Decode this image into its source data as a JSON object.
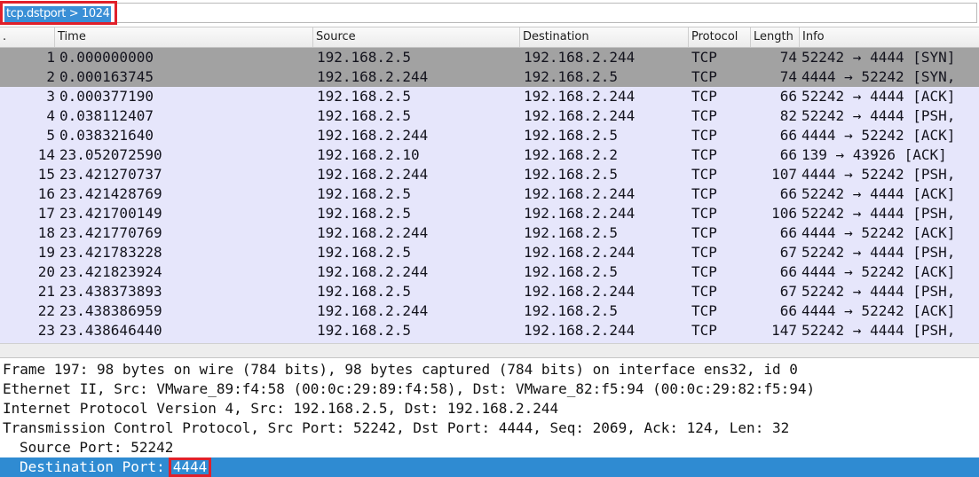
{
  "filter": {
    "value": "tcp.dstport > 1024"
  },
  "columns": {
    "no": ".",
    "time": "Time",
    "source": "Source",
    "destination": "Destination",
    "protocol": "Protocol",
    "length": "Length",
    "info": "Info"
  },
  "packets": [
    {
      "no": "1",
      "time": "0.000000000",
      "source": "192.168.2.5",
      "destination": "192.168.2.244",
      "protocol": "TCP",
      "length": "74",
      "info": "52242 → 4444 [SYN]"
    },
    {
      "no": "2",
      "time": "0.000163745",
      "source": "192.168.2.244",
      "destination": "192.168.2.5",
      "protocol": "TCP",
      "length": "74",
      "info": "4444 → 52242 [SYN,"
    },
    {
      "no": "3",
      "time": "0.000377190",
      "source": "192.168.2.5",
      "destination": "192.168.2.244",
      "protocol": "TCP",
      "length": "66",
      "info": "52242 → 4444 [ACK]"
    },
    {
      "no": "4",
      "time": "0.038112407",
      "source": "192.168.2.5",
      "destination": "192.168.2.244",
      "protocol": "TCP",
      "length": "82",
      "info": "52242 → 4444 [PSH,"
    },
    {
      "no": "5",
      "time": "0.038321640",
      "source": "192.168.2.244",
      "destination": "192.168.2.5",
      "protocol": "TCP",
      "length": "66",
      "info": "4444 → 52242 [ACK]"
    },
    {
      "no": "14",
      "time": "23.052072590",
      "source": "192.168.2.10",
      "destination": "192.168.2.2",
      "protocol": "TCP",
      "length": "66",
      "info": "139 → 43926 [ACK]"
    },
    {
      "no": "15",
      "time": "23.421270737",
      "source": "192.168.2.244",
      "destination": "192.168.2.5",
      "protocol": "TCP",
      "length": "107",
      "info": "4444 → 52242 [PSH,"
    },
    {
      "no": "16",
      "time": "23.421428769",
      "source": "192.168.2.5",
      "destination": "192.168.2.244",
      "protocol": "TCP",
      "length": "66",
      "info": "52242 → 4444 [ACK]"
    },
    {
      "no": "17",
      "time": "23.421700149",
      "source": "192.168.2.5",
      "destination": "192.168.2.244",
      "protocol": "TCP",
      "length": "106",
      "info": "52242 → 4444 [PSH,"
    },
    {
      "no": "18",
      "time": "23.421770769",
      "source": "192.168.2.244",
      "destination": "192.168.2.5",
      "protocol": "TCP",
      "length": "66",
      "info": "4444 → 52242 [ACK]"
    },
    {
      "no": "19",
      "time": "23.421783228",
      "source": "192.168.2.5",
      "destination": "192.168.2.244",
      "protocol": "TCP",
      "length": "67",
      "info": "52242 → 4444 [PSH,"
    },
    {
      "no": "20",
      "time": "23.421823924",
      "source": "192.168.2.244",
      "destination": "192.168.2.5",
      "protocol": "TCP",
      "length": "66",
      "info": "4444 → 52242 [ACK]"
    },
    {
      "no": "21",
      "time": "23.438373893",
      "source": "192.168.2.5",
      "destination": "192.168.2.244",
      "protocol": "TCP",
      "length": "67",
      "info": "52242 → 4444 [PSH,"
    },
    {
      "no": "22",
      "time": "23.438386959",
      "source": "192.168.2.244",
      "destination": "192.168.2.5",
      "protocol": "TCP",
      "length": "66",
      "info": "4444 → 52242 [ACK]"
    },
    {
      "no": "23",
      "time": "23.438646440",
      "source": "192.168.2.5",
      "destination": "192.168.2.244",
      "protocol": "TCP",
      "length": "147",
      "info": "52242 → 4444 [PSH,"
    }
  ],
  "details": {
    "frame": "Frame 197: 98 bytes on wire (784 bits), 98 bytes captured (784 bits) on interface ens32, id 0",
    "ethernet": "Ethernet II, Src: VMware_89:f4:58 (00:0c:29:89:f4:58), Dst: VMware_82:f5:94 (00:0c:29:82:f5:94)",
    "ip": "Internet Protocol Version 4, Src: 192.168.2.5, Dst: 192.168.2.244",
    "tcp": "Transmission Control Protocol, Src Port: 52242, Dst Port: 4444, Seq: 2069, Ack: 124, Len: 32",
    "src_port": "Source Port: 52242",
    "dst_port_label": "Destination Port:",
    "dst_port_value": "4444"
  },
  "colors": {
    "row_background": "#e6e6fb",
    "selected_row": "#a2a2a2",
    "highlight_box": "#e0202a",
    "detail_selection": "#2f8bd2"
  }
}
